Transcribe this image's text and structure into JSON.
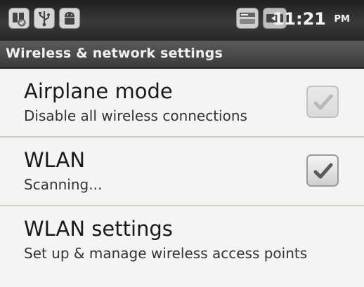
{
  "status_bar": {
    "icons_left": [
      "debug-icon",
      "usb-icon",
      "android-icon"
    ],
    "icons_right": [
      "signal-icon",
      "battery-icon"
    ],
    "time": "11:21",
    "ampm": "PM"
  },
  "title_bar": {
    "title": "Wireless & network settings"
  },
  "settings": [
    {
      "title": "Airplane mode",
      "summary": "Disable all wireless connections",
      "checkbox": {
        "checked": true,
        "enabled": false
      }
    },
    {
      "title": "WLAN",
      "summary": "Scanning...",
      "checkbox": {
        "checked": true,
        "enabled": true
      }
    },
    {
      "title": "WLAN settings",
      "summary": "Set up & manage wireless access points"
    }
  ],
  "colors": {
    "status_bar_bg": "#2b2b2b",
    "title_bar_bg": "#4a4a4a",
    "list_bg": "#f4f4f2",
    "check_enabled": "#5a5a5a",
    "check_disabled": "#b8b8b8"
  }
}
